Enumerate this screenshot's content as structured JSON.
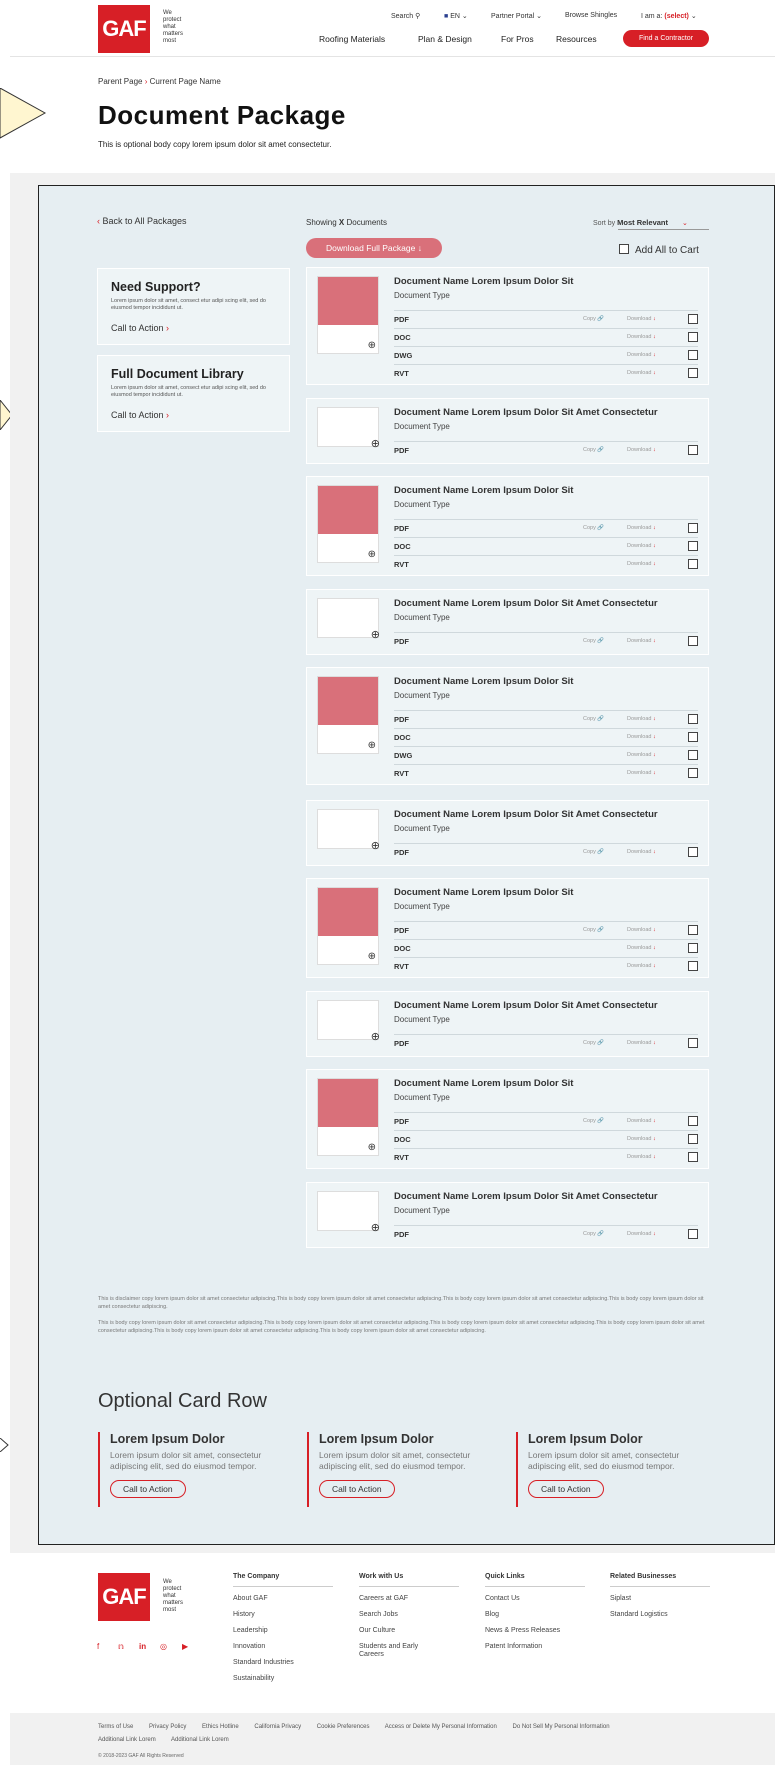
{
  "header": {
    "logo_text": "GAF",
    "tagline": [
      "We",
      "protect",
      "what",
      "matters",
      "most"
    ],
    "search_label": "Search",
    "lang_label": "EN",
    "partner_portal": "Partner Portal",
    "browse_shingles": "Browse Shingles",
    "i_am_a": "I am a:",
    "select": "(select)",
    "nav": [
      "Roofing Materials",
      "Plan & Design",
      "For Pros",
      "Resources"
    ],
    "cta": "Find a Contractor"
  },
  "breadcrumb": {
    "parent": "Parent Page",
    "current": "Current Page Name"
  },
  "page_title": "Document Package",
  "intro": "This is optional body copy lorem ipsum dolor sit amet consectetur.",
  "back_link": "Back to All Packages",
  "support_cards": [
    {
      "title": "Need Support?",
      "body": "Lorem ipsum dolor sit amet, consect etur adipi scing elit, sed do eiusmod tempor incididunt ut.",
      "cta": "Call to Action"
    },
    {
      "title": "Full Document Library",
      "body": "Lorem ipsum dolor sit amet, consect etur adipi scing elit, sed do eiusmod tempor incididunt ut.",
      "cta": "Call to Action"
    }
  ],
  "results": {
    "showing_prefix": "Showing",
    "showing_count": "X",
    "showing_suffix": "Documents",
    "sort_label": "Sort by",
    "sort_value": "Most Relevant",
    "download_full": "Download Full Package",
    "add_all": "Add All to Cart"
  },
  "doc_labels": {
    "copy": "Copy",
    "download": "Download",
    "type": "Document Type"
  },
  "documents": [
    {
      "name": "Document Name Lorem Ipsum Dolor Sit",
      "files": [
        "PDF",
        "DOC",
        "DWG",
        "RVT"
      ],
      "thumb": "portrait"
    },
    {
      "name": "Document Name Lorem Ipsum Dolor Sit Amet Consectetur",
      "files": [
        "PDF"
      ],
      "thumb": "landscape"
    },
    {
      "name": "Document Name Lorem Ipsum Dolor Sit",
      "files": [
        "PDF",
        "DOC",
        "RVT"
      ],
      "thumb": "portrait"
    },
    {
      "name": "Document Name Lorem Ipsum Dolor Sit Amet Consectetur",
      "files": [
        "PDF"
      ],
      "thumb": "landscape"
    },
    {
      "name": "Document Name Lorem Ipsum Dolor Sit",
      "files": [
        "PDF",
        "DOC",
        "DWG",
        "RVT"
      ],
      "thumb": "portrait"
    },
    {
      "name": "Document Name Lorem Ipsum Dolor Sit Amet Consectetur",
      "files": [
        "PDF"
      ],
      "thumb": "landscape"
    },
    {
      "name": "Document Name Lorem Ipsum Dolor Sit",
      "files": [
        "PDF",
        "DOC",
        "RVT"
      ],
      "thumb": "portrait"
    },
    {
      "name": "Document Name Lorem Ipsum Dolor Sit Amet Consectetur",
      "files": [
        "PDF"
      ],
      "thumb": "landscape"
    },
    {
      "name": "Document Name Lorem Ipsum Dolor Sit",
      "files": [
        "PDF",
        "DOC",
        "RVT"
      ],
      "thumb": "portrait"
    },
    {
      "name": "Document Name Lorem Ipsum Dolor Sit Amet Consectetur",
      "files": [
        "PDF"
      ],
      "thumb": "landscape"
    }
  ],
  "disclaimer": [
    "This is disclaimer copy lorem ipsum dolor sit amet consectetur adipiscing.This is body copy lorem ipsum dolor sit amet consectetur adipiscing.This is body copy lorem ipsum dolor sit amet consectetur adipiscing.This is body copy lorem ipsum dolor sit amet consectetur adipiscing.",
    "This is body copy lorem ipsum dolor sit amet consectetur adipiscing.This is body copy lorem ipsum dolor sit amet consectetur adipiscing.This is body copy lorem ipsum dolor sit amet consectetur adipiscing.This is body copy lorem ipsum dolor sit amet consectetur adipiscing.This is body copy lorem ipsum dolor sit amet consectetur adipiscing.This is body copy lorem ipsum dolor sit amet consectetur adipiscing."
  ],
  "optional_row": {
    "title": "Optional Card Row",
    "cards": [
      {
        "title": "Lorem Ipsum Dolor",
        "body": "Lorem ipsum dolor sit amet, consectetur adipiscing elit, sed do eiusmod tempor.",
        "cta": "Call to Action"
      },
      {
        "title": "Lorem Ipsum Dolor",
        "body": "Lorem ipsum dolor sit amet, consectetur adipiscing elit, sed do eiusmod tempor.",
        "cta": "Call to Action"
      },
      {
        "title": "Lorem Ipsum Dolor",
        "body": "Lorem ipsum dolor sit amet, consectetur adipiscing elit, sed do eiusmod tempor.",
        "cta": "Call to Action"
      }
    ]
  },
  "footer": {
    "columns": [
      {
        "heading": "The Company",
        "items": [
          "About GAF",
          "History",
          "Leadership",
          "Innovation",
          "Standard Industries",
          "Sustainability"
        ]
      },
      {
        "heading": "Work with Us",
        "items": [
          "Careers at GAF",
          "Search Jobs",
          "Our Culture",
          "Students and Early Careers"
        ]
      },
      {
        "heading": "Quick Links",
        "items": [
          "Contact Us",
          "Blog",
          "News & Press Releases",
          "Patent Information"
        ]
      },
      {
        "heading": "Related Businesses",
        "items": [
          "Siplast",
          "Standard Logistics"
        ]
      }
    ],
    "social_icons": [
      "facebook-icon",
      "twitter-icon",
      "linkedin-icon",
      "instagram-icon",
      "youtube-icon"
    ],
    "legal_links": [
      "Terms of Use",
      "Privacy Policy",
      "Ethics Hotline",
      "California Privacy",
      "Cookie Preferences",
      "Access or Delete My Personal Information",
      "Do Not Sell My Personal Information",
      "Additional Link Lorem",
      "Additional Link Lorem"
    ],
    "copyright": "© 2018-2023 GAF All Rights Reserved"
  },
  "colors": {
    "brand_red": "#d71f26",
    "light_red": "#d9707a",
    "panel_bg": "#e6eef2"
  }
}
